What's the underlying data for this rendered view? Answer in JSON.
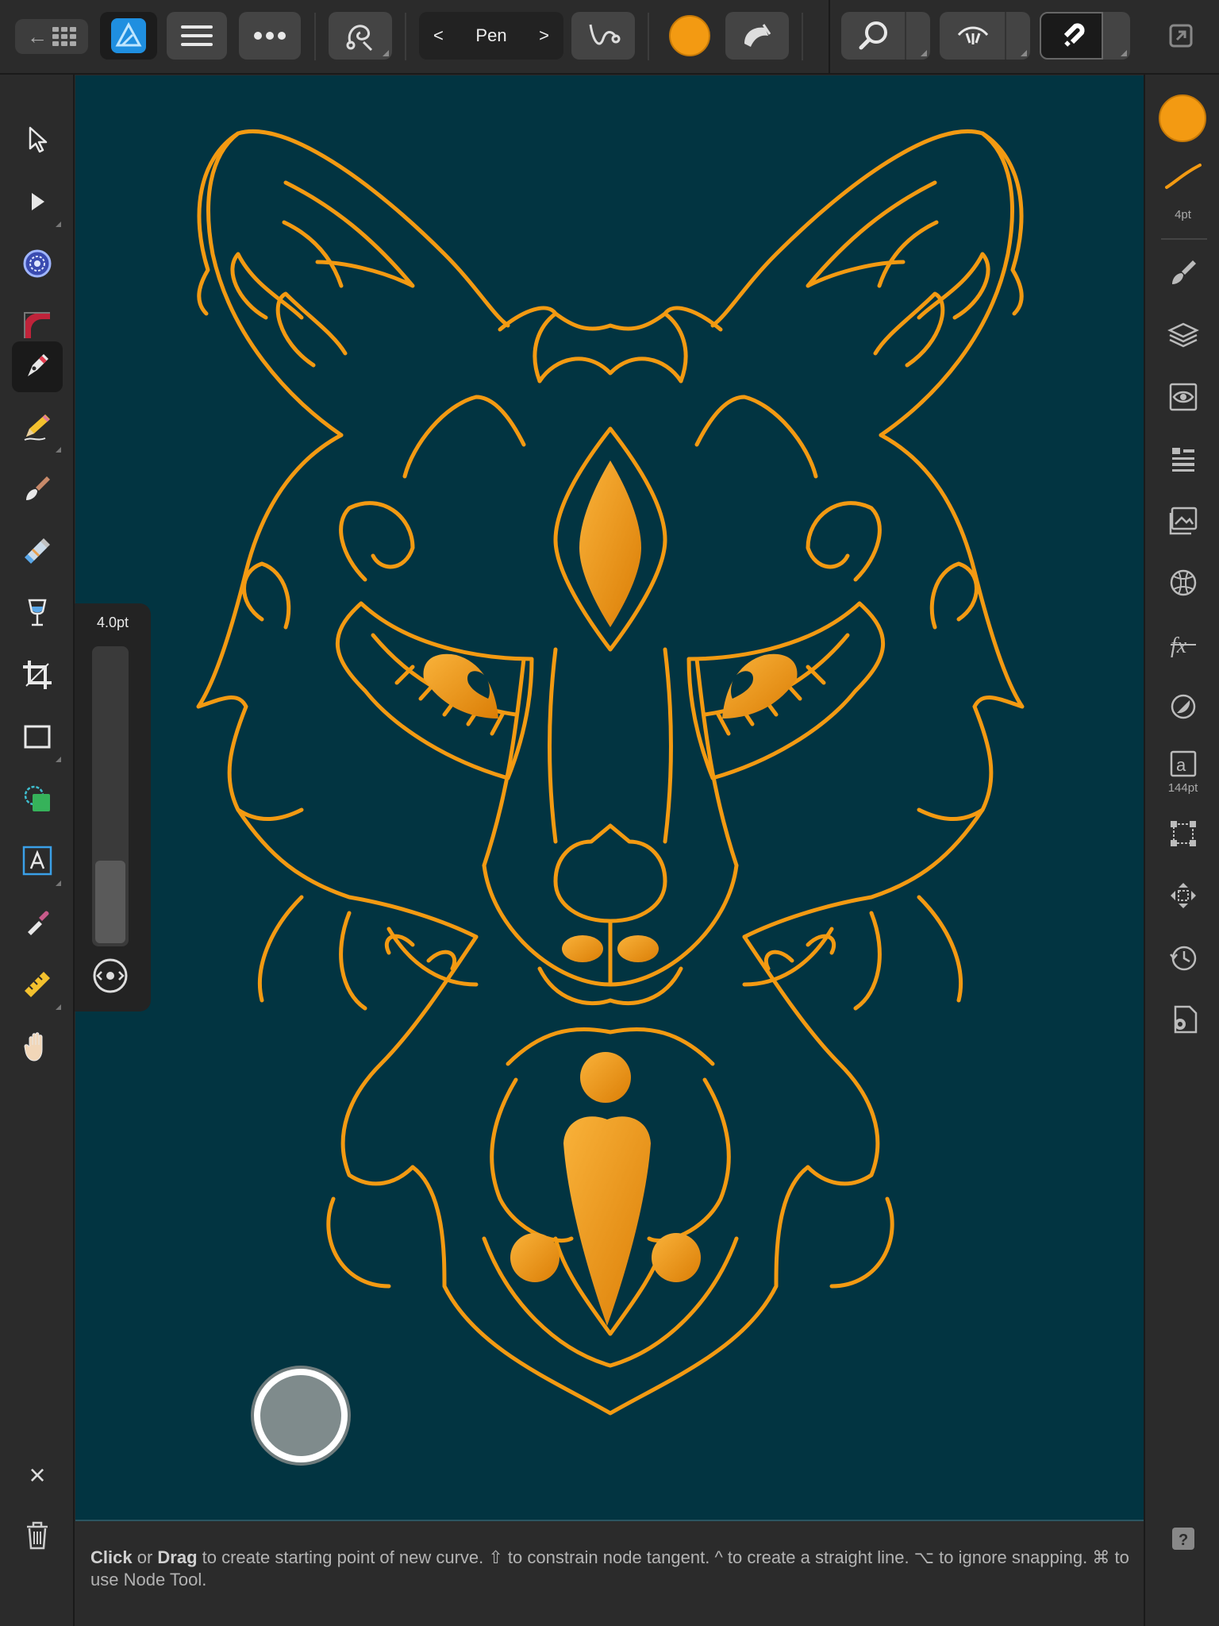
{
  "toolbar": {
    "back_label": "←",
    "tool_name": "Pen",
    "prev_label": "<",
    "next_label": ">",
    "fill_color": "#F39A12",
    "icons": [
      "back-grid-icon",
      "affinity-designer-logo",
      "hamburger-menu-icon",
      "more-icon",
      "snapping-icon",
      "pen-mode-icon",
      "fill-color-swatch",
      "stroke-style-icon",
      "zoom-icon",
      "view-mode-icon",
      "snapping-magnet-icon",
      "fullscreen-icon"
    ]
  },
  "left_tools": [
    {
      "name": "move-tool",
      "icon": "cursor-arrow-icon"
    },
    {
      "name": "node-tool",
      "icon": "node-arrow-icon"
    },
    {
      "name": "contour-tool",
      "icon": "contour-icon"
    },
    {
      "name": "corner-tool",
      "icon": "corner-icon"
    },
    {
      "name": "pen-tool",
      "icon": "pen-nib-icon",
      "active": true
    },
    {
      "name": "pencil-tool",
      "icon": "pencil-icon"
    },
    {
      "name": "vector-brush-tool",
      "icon": "brush-icon"
    },
    {
      "name": "fill-tool",
      "icon": "fill-icon"
    },
    {
      "name": "transparency-tool",
      "icon": "glass-icon"
    },
    {
      "name": "crop-tool",
      "icon": "crop-icon"
    },
    {
      "name": "rectangle-tool",
      "icon": "rectangle-icon"
    },
    {
      "name": "shape-builder-tool",
      "icon": "shape-builder-icon"
    },
    {
      "name": "text-tool",
      "icon": "text-icon"
    },
    {
      "name": "color-picker-tool",
      "icon": "eyedropper-icon"
    },
    {
      "name": "measure-tool",
      "icon": "ruler-icon"
    },
    {
      "name": "view-tool",
      "icon": "hand-icon"
    }
  ],
  "width_popover": {
    "label": "4.0pt",
    "level": 0.28
  },
  "right_panel": {
    "color": "#F39A12",
    "stroke_label": "4pt",
    "text_size_label": "144pt",
    "icons": [
      "brush-panel-icon",
      "layers-icon",
      "appearance-icon",
      "stroke-panel-icon",
      "assets-icon",
      "navigator-icon",
      "fx-icon",
      "adjustments-icon",
      "text-styles-icon",
      "transform-icon",
      "move-icon",
      "history-icon",
      "settings-icon",
      "help-icon"
    ]
  },
  "bottom": {
    "close_label": "×",
    "hint_parts": {
      "click": "Click",
      "or": " or ",
      "drag": "Drag",
      "rest": " to create starting point of new curve. ⇧ to constrain node tangent. ^ to create a straight line. ⌥ to ignore snapping. ⌘ to use Node Tool."
    }
  }
}
